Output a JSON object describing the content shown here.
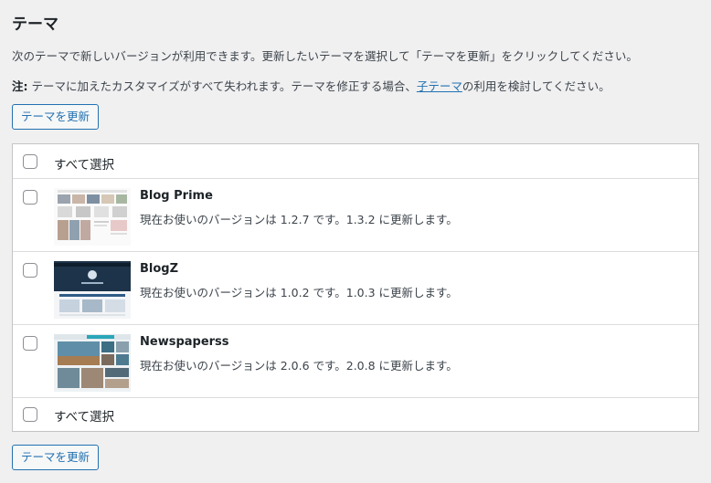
{
  "page": {
    "title": "テーマ",
    "description": "次のテーマで新しいバージョンが利用できます。更新したいテーマを選択して「テーマを更新」をクリックしてください。",
    "note_label": "注:",
    "note_text": " テーマに加えたカスタマイズがすべて失われます。テーマを修正する場合、",
    "note_link": "子テーマ",
    "note_tail": "の利用を検討してください。",
    "update_button": "テーマを更新"
  },
  "table": {
    "select_all": "すべて選択",
    "themes": [
      {
        "name": "Blog Prime",
        "status": "現在お使いのバージョンは 1.2.7 です。1.3.2 に更新します。"
      },
      {
        "name": "BlogZ",
        "status": "現在お使いのバージョンは 1.0.2 です。1.0.3 に更新します。"
      },
      {
        "name": "Newspaperss",
        "status": "現在お使いのバージョンは 2.0.6 です。2.0.8 に更新します。"
      }
    ]
  },
  "colors": {
    "background": "#f0f0f1",
    "accent": "#2271b1",
    "border": "#c3c4c7",
    "text": "#3c434a"
  }
}
